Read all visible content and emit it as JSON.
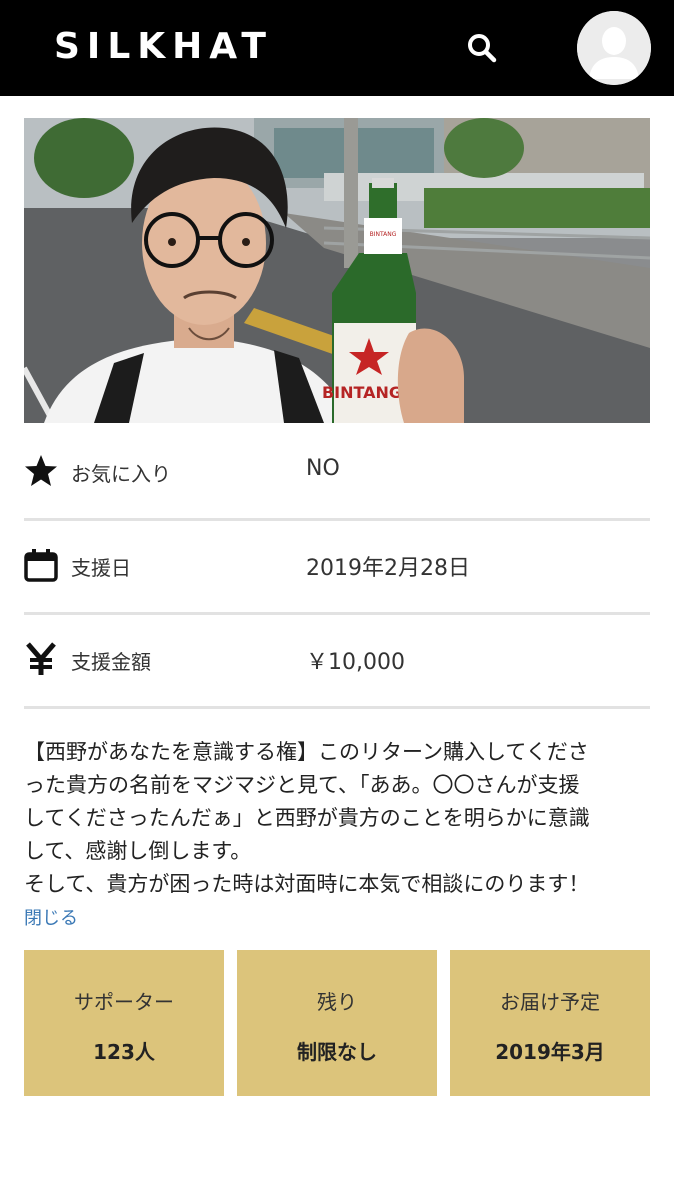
{
  "header": {
    "logo": "SILKHAT",
    "search_icon": "search-icon",
    "avatar_icon": "user-avatar-icon"
  },
  "photo": {
    "bottle_label_1": "BINTANG",
    "bottle_label_2": "BINTANG"
  },
  "details": [
    {
      "icon": "star-icon",
      "label": "お気に入り",
      "value": "NO"
    },
    {
      "icon": "calendar-icon",
      "label": "支援日",
      "value": "2019年2月28日"
    },
    {
      "icon": "yen-icon",
      "label": "支援金額",
      "value": "￥10,000"
    }
  ],
  "description": {
    "lines": [
      "【西野があなたを意識する権】このリターン購入してくださ",
      "った貴方の名前をマジマジと見て、「ああ。〇〇さんが支援",
      "してくださったんだぁ」と西野が貴方のことを明らかに意識",
      "して、感謝し倒します。",
      "そして、貴方が困った時は対面時に本気で相談にのります！"
    ],
    "close_link": "閉じる"
  },
  "stats": [
    {
      "label": "サポーター",
      "value": "123人"
    },
    {
      "label": "残り",
      "value": "制限なし"
    },
    {
      "label": "お届け予定",
      "value": "2019年3月"
    }
  ],
  "colors": {
    "header_bg": "#000000",
    "stat_box_bg": "#dcc47b",
    "link": "#3a78b5",
    "divider": "#e2e2e2"
  }
}
